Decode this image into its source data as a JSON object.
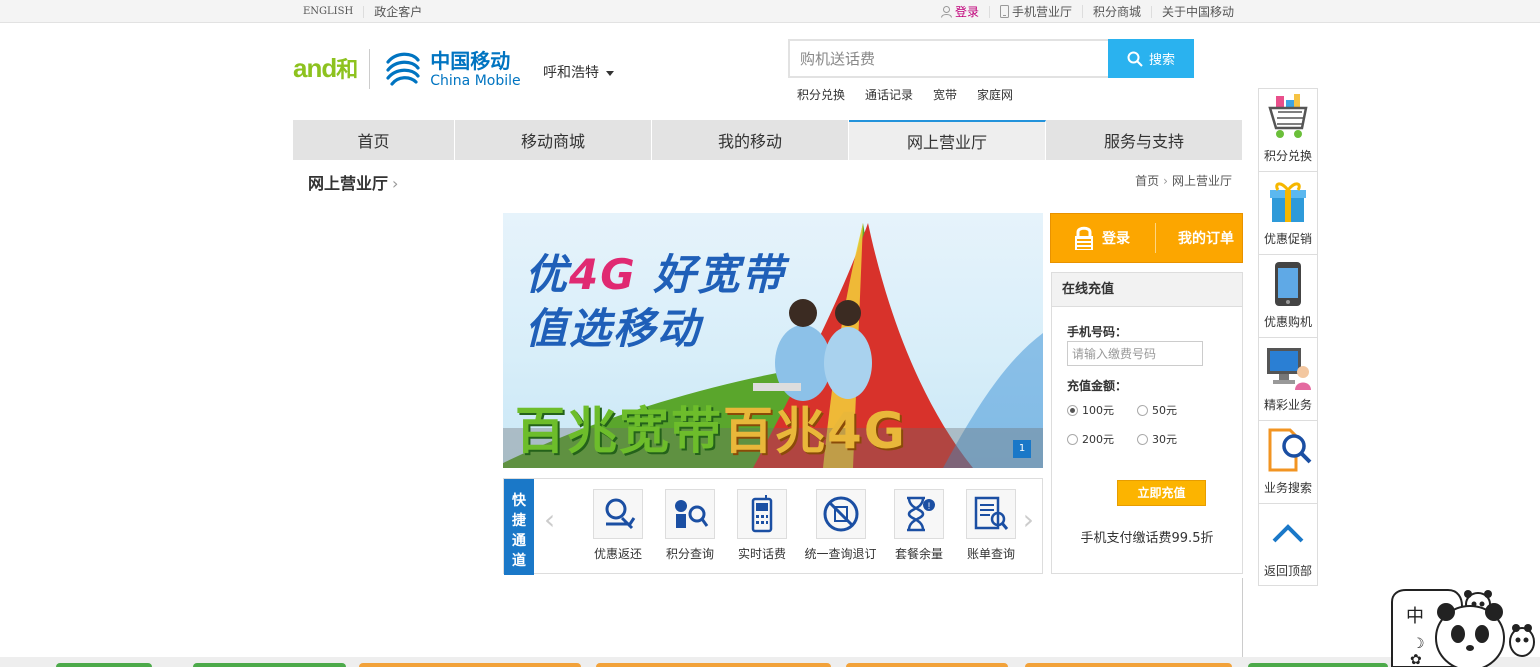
{
  "topbar": {
    "left": [
      "ENGLISH",
      "政企客户"
    ],
    "right": [
      "登录",
      "手机营业厅",
      "积分商城",
      "关于中国移动"
    ]
  },
  "header": {
    "logo_and": "and",
    "logo_he": "和",
    "logo_cn": "中国移动",
    "logo_en": "China Mobile",
    "city": "呼和浩特"
  },
  "search": {
    "placeholder": "购机送话费",
    "button": "搜索",
    "hot": [
      "积分兑换",
      "通话记录",
      "宽带",
      "家庭网"
    ]
  },
  "nav": {
    "tabs": [
      "首页",
      "移动商城",
      "我的移动",
      "网上营业厅",
      "服务与支持"
    ],
    "active": "网上营业厅"
  },
  "breadcrumb": {
    "title": "网上营业厅",
    "home": "首页",
    "current": "网上营业厅"
  },
  "banner": {
    "line1_a": "优",
    "line1_b": "4G",
    "line1_c": " 好宽带",
    "line2": "值选移动",
    "line3_a": "百兆宽带",
    "line3_b": "百兆4G",
    "index": "1"
  },
  "quick": {
    "label": [
      "快",
      "捷",
      "通",
      "道"
    ],
    "items": [
      "优惠返还",
      "积分查询",
      "实时话费",
      "统一查询退订",
      "套餐余量",
      "账单查询"
    ]
  },
  "login_box": {
    "login": "登录",
    "orders": "我的订单"
  },
  "recharge": {
    "title": "在线充值",
    "phone_label": "手机号码：",
    "phone_placeholder": "请输入缴费号码",
    "amount_label": "充值金额：",
    "amounts": [
      "100元",
      "50元",
      "200元",
      "30元"
    ],
    "selected": "100元",
    "submit": "立即充值",
    "promo": "手机支付缴话费99.5折"
  },
  "sidebar": {
    "items": [
      "积分兑换",
      "优惠促销",
      "优惠购机",
      "精彩业务",
      "业务搜索",
      "返回顶部"
    ]
  },
  "widget": {
    "char1": "中"
  },
  "colors": {
    "accent_blue": "#2393db",
    "search_blue": "#2ab2ef",
    "orange": "#fca600",
    "green": "#8dc21f"
  }
}
